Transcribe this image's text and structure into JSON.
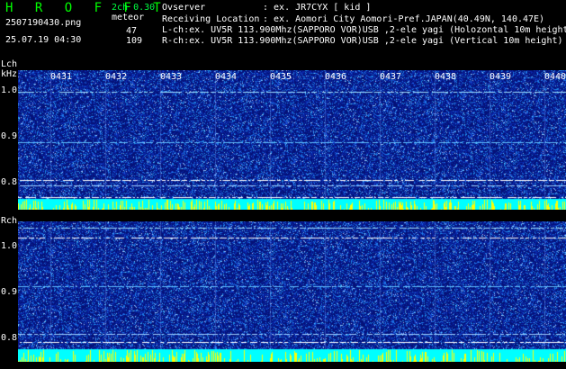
{
  "header": {
    "app_title": "H R O F F T",
    "channels": "2ch 0.30",
    "mode": "meteor",
    "filename": "2507190430.png",
    "datetime": "25.07.19 04:30",
    "count_l": "47",
    "count_r": "109",
    "observer_label": "Ovserver",
    "observer_value": ": ex. JR7CYX [ kid ]",
    "location_label": "Receiving Location",
    "location_value": ": ex. Aomori City Aomori-Pref.JAPAN(40.49N, 140.47E)",
    "lch_info": "L-ch:ex. UV5R 113.900Mhz(SAPPORO VOR)USB ,2-ele yagi (Holozontal 10m height)",
    "rch_info": "R-ch:ex. UV5R 113.900Mhz(SAPPORO VOR)USB ,2-ele yagi (Vertical 10m height)"
  },
  "lch": {
    "label": "Lch",
    "unit": "kHz",
    "ticks": [
      "1.0",
      "0.9",
      "0.8"
    ]
  },
  "rch": {
    "label": "Rch",
    "ticks": [
      "1.0",
      "0.9",
      "0.8"
    ]
  },
  "minutes": [
    "0431",
    "0432",
    "0433",
    "0434",
    "0435",
    "0436",
    "0437",
    "0438",
    "0439",
    "0440"
  ],
  "colors": {
    "background": "#000000",
    "spectrum_base": "#0a1aa0",
    "spectrum_noise": "#3c78ff",
    "signal_line": "#00ffff",
    "meteor_bar": "#ffff00",
    "header_green": "#00ff40"
  }
}
